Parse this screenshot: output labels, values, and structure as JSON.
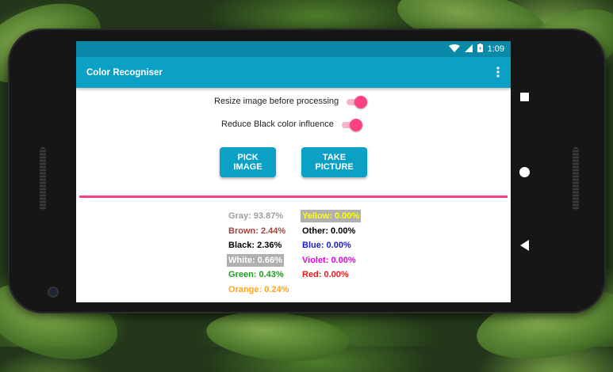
{
  "status_bar": {
    "time": "1:09",
    "icons": [
      "wifi-icon",
      "signal-icon",
      "battery-icon"
    ]
  },
  "app_bar": {
    "title": "Color Recogniser",
    "menu_icon": "more-vert-icon"
  },
  "settings": {
    "resize": {
      "label": "Resize image before processing",
      "enabled": true
    },
    "reduce_black": {
      "label": "Reduce Black color influence",
      "enabled": true
    }
  },
  "buttons": {
    "pick_image": "PICK IMAGE",
    "take_picture": "TAKE PICTURE"
  },
  "progress": {
    "value": 1.0,
    "color": "#ff4081"
  },
  "results": {
    "left": [
      {
        "text": "Gray: 93.87%",
        "color": "#9e9e9e",
        "bg": ""
      },
      {
        "text": "Brown: 2.44%",
        "color": "#a0453a",
        "bg": ""
      },
      {
        "text": "Black: 2.36%",
        "color": "#000000",
        "bg": ""
      },
      {
        "text": "White: 0.66%",
        "color": "#ffffff",
        "bg": "#b0b0b0"
      },
      {
        "text": "Green: 0.43%",
        "color": "#1e9b1e",
        "bg": ""
      },
      {
        "text": "Orange: 0.24%",
        "color": "#ffa31a",
        "bg": ""
      }
    ],
    "right": [
      {
        "text": "Yellow: 0.00%",
        "color": "#ffff00",
        "bg": "#b0b0b0"
      },
      {
        "text": "Other: 0.00%",
        "color": "#000000",
        "bg": ""
      },
      {
        "text": "Blue: 0.00%",
        "color": "#1a1ad6",
        "bg": ""
      },
      {
        "text": "Violet: 0.00%",
        "color": "#e000e0",
        "bg": ""
      },
      {
        "text": "Red: 0.00%",
        "color": "#e81818",
        "bg": ""
      }
    ]
  },
  "nav_bar": {
    "icons": [
      "recents-square-icon",
      "home-circle-icon",
      "back-triangle-icon"
    ]
  },
  "colors": {
    "primary": "#0ba1c4",
    "primary_dark": "#0a8aa8",
    "accent": "#ff4081"
  }
}
